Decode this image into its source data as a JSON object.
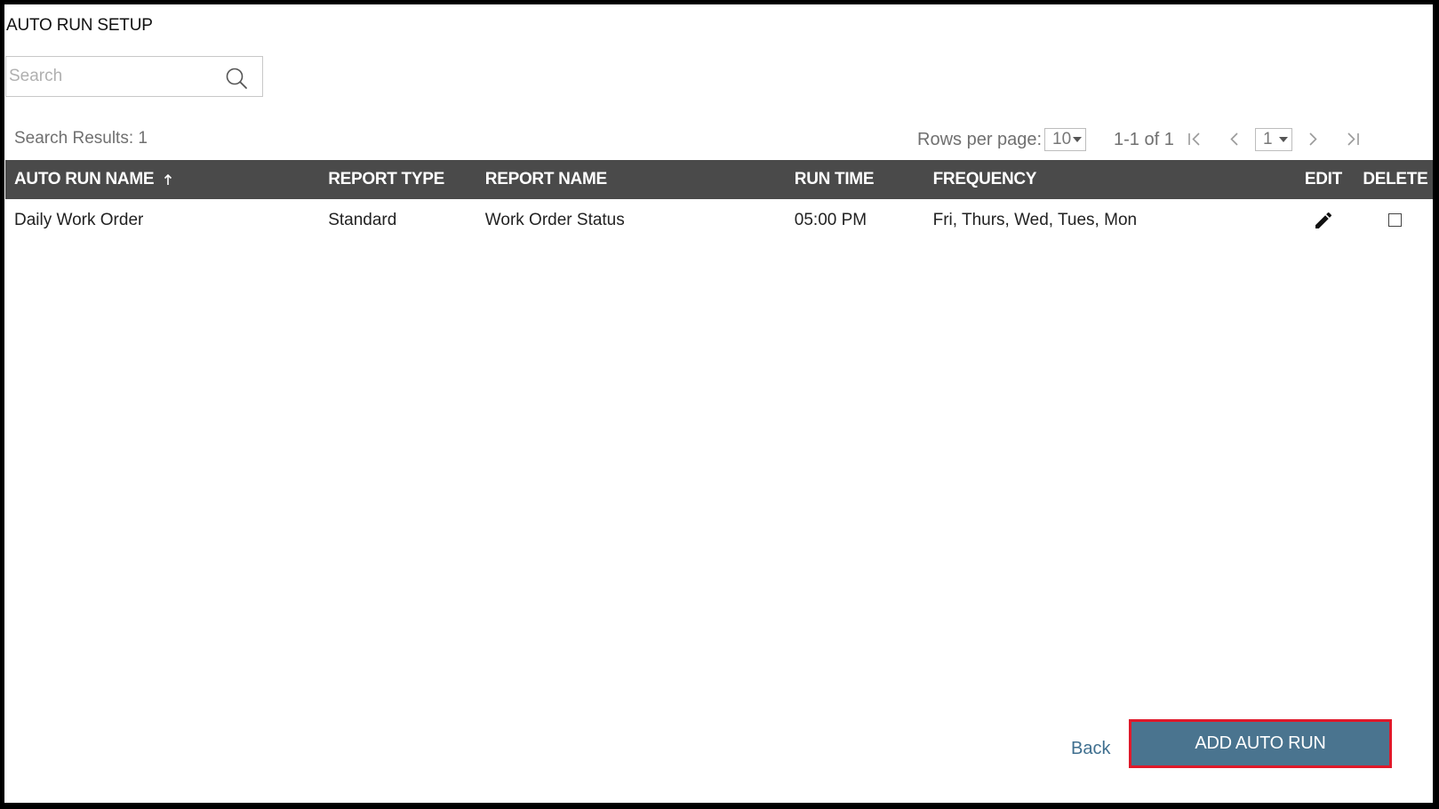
{
  "page": {
    "title": "AUTO RUN SETUP"
  },
  "search": {
    "placeholder": "Search",
    "value": ""
  },
  "results": {
    "label": "Search Results: 1"
  },
  "pagination": {
    "rows_per_page_label": "Rows per page:",
    "rows_per_page_value": "10",
    "range_label": "1-1 of 1",
    "page_value": "1"
  },
  "table": {
    "columns": {
      "auto_run_name": "AUTO RUN NAME",
      "report_type": "REPORT TYPE",
      "report_name": "REPORT NAME",
      "run_time": "RUN TIME",
      "frequency": "FREQUENCY",
      "edit": "EDIT",
      "delete": "DELETE"
    },
    "sort": {
      "column": "auto_run_name",
      "direction": "ascending"
    },
    "rows": [
      {
        "auto_run_name": "Daily Work Order",
        "report_type": "Standard",
        "report_name": "Work Order Status",
        "run_time": "05:00 PM",
        "frequency": "Fri, Thurs, Wed, Tues, Mon",
        "delete_checked": false
      }
    ]
  },
  "actions": {
    "back_label": "Back",
    "add_label": "ADD AUTO RUN"
  },
  "colors": {
    "header_bg": "#4a4a4a",
    "primary_button": "#4a748f",
    "highlight_border": "#e0192a",
    "link": "#3f6f8f"
  },
  "icons": {
    "search": "search-icon",
    "sort": "arrow-up-icon",
    "edit": "pencil-icon",
    "first_page": "first-page-icon",
    "prev_page": "chevron-left-icon",
    "next_page": "chevron-right-icon",
    "last_page": "last-page-icon"
  }
}
